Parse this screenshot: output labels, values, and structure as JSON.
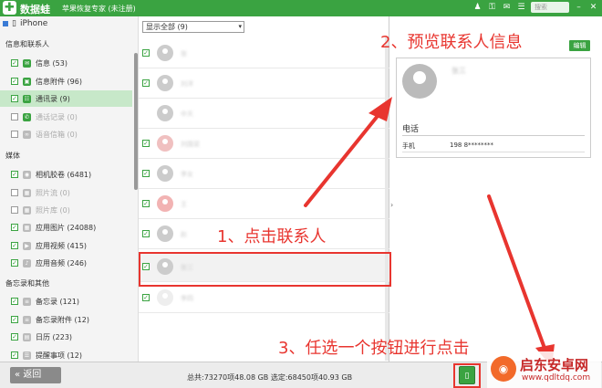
{
  "app": {
    "logo_glyph": "✚",
    "name": "数据蛙",
    "subtitle": "苹果恢复专家 (未注册)",
    "search_placeholder": "搜索"
  },
  "sidebar": {
    "device": "iPhone",
    "sections": [
      {
        "title": "信息和联系人"
      },
      {
        "title": "媒体"
      },
      {
        "title": "备忘录和其他"
      }
    ],
    "items": [
      {
        "label": "信息 (53)",
        "checked": true
      },
      {
        "label": "信息附件 (96)",
        "checked": true
      },
      {
        "label": "通讯录 (9)",
        "checked": true,
        "active": true
      },
      {
        "label": "通话记录 (0)",
        "checked": false,
        "disabled": true
      },
      {
        "label": "语音信箱 (0)",
        "checked": false,
        "disabled": true
      },
      {
        "label": "相机胶卷 (6481)",
        "checked": true
      },
      {
        "label": "照片流 (0)",
        "checked": false,
        "disabled": true
      },
      {
        "label": "照片库 (0)",
        "checked": false,
        "disabled": true
      },
      {
        "label": "应用图片 (24088)",
        "checked": true
      },
      {
        "label": "应用视频 (415)",
        "checked": true
      },
      {
        "label": "应用音频 (246)",
        "checked": true
      },
      {
        "label": "备忘录 (121)",
        "checked": true
      },
      {
        "label": "备忘录附件 (12)",
        "checked": true
      },
      {
        "label": "日历 (223)",
        "checked": true
      },
      {
        "label": "提醒事项 (12)",
        "checked": true
      }
    ]
  },
  "list": {
    "filter_value": "显示全部 (9)",
    "rows": [
      {
        "name": "张",
        "checked": true
      },
      {
        "name": "刘洋",
        "checked": true
      },
      {
        "name": "中天"
      },
      {
        "name": "刘国梁",
        "checked": true
      },
      {
        "name": "李女",
        "checked": true
      },
      {
        "name": "王",
        "checked": true
      },
      {
        "name": "赵",
        "checked": true
      },
      {
        "name": "张三",
        "checked": true,
        "selected": true
      },
      {
        "name": "李四",
        "checked": true
      }
    ]
  },
  "detail": {
    "name": "张三",
    "section": "电话",
    "field_label": "手机",
    "field_value": "198 8********",
    "edit_label": "编辑"
  },
  "footer": {
    "back_label": "返回",
    "stats": "总共:73270项48.08 GB 选定:68450项40.93 GB"
  },
  "annotations": {
    "step1": "1、点击联系人",
    "step2": "2、预览联系人信息",
    "step3": "3、任选一个按钮进行点击",
    "color": "#e8352f"
  },
  "watermark": {
    "name": "启东安卓网",
    "url": "www.qdltdq.com"
  }
}
